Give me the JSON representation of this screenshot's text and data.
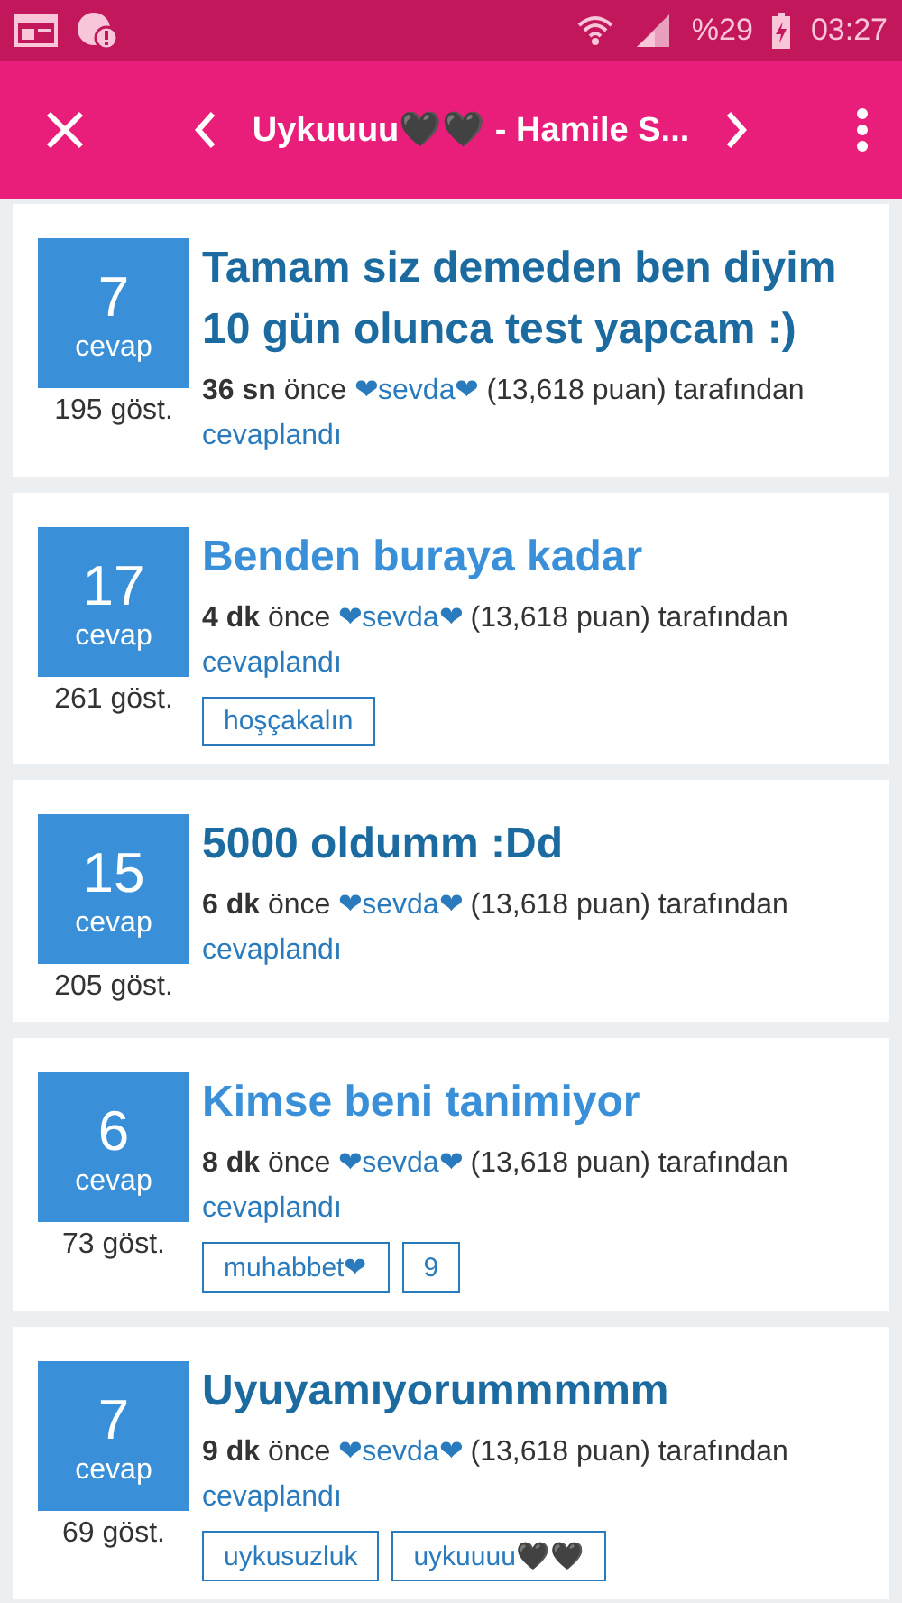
{
  "status_bar": {
    "battery": "%29",
    "time": "03:27"
  },
  "app_bar": {
    "title": "Uykuuuu🖤🖤 - Hamile S..."
  },
  "questions": [
    {
      "answers": "7",
      "answers_label": "cevap",
      "views": "195 göst.",
      "title": "Tamam siz demeden ben diyim 10 gün olunca test yapcam :)",
      "visited": true,
      "time": "36 sn",
      "ago": "önce",
      "user": "❤sevda❤",
      "points": "(13,618 puan) tarafından",
      "action": "cevaplandı"
    },
    {
      "answers": "17",
      "answers_label": "cevap",
      "views": "261 göst.",
      "title": "Benden buraya kadar",
      "visited": false,
      "time": "4 dk",
      "ago": "önce",
      "user": "❤sevda❤",
      "points": "(13,618 puan) tarafından",
      "action": "cevaplandı",
      "tags": [
        "hoşçakalın"
      ]
    },
    {
      "answers": "15",
      "answers_label": "cevap",
      "views": "205 göst.",
      "title": "5000 oldumm :Dd",
      "visited": true,
      "time": "6 dk",
      "ago": "önce",
      "user": "❤sevda❤",
      "points": "(13,618 puan) tarafından",
      "action": "cevaplandı"
    },
    {
      "answers": "6",
      "answers_label": "cevap",
      "views": "73 göst.",
      "title": "Kimse beni tanimiyor",
      "visited": false,
      "time": "8 dk",
      "ago": "önce",
      "user": "❤sevda❤",
      "points": "(13,618 puan) tarafından",
      "action": "cevaplandı",
      "tags": [
        "muhabbet❤",
        "9"
      ]
    },
    {
      "answers": "7",
      "answers_label": "cevap",
      "views": "69 göst.",
      "title": "Uyuyamıyorummmmm",
      "visited": true,
      "time": "9 dk",
      "ago": "önce",
      "user": "❤sevda❤",
      "points": "(13,618 puan) tarafından",
      "action": "cevaplandı",
      "tags": [
        "uykusuzluk",
        "uykuuuu🖤🖤"
      ]
    }
  ]
}
